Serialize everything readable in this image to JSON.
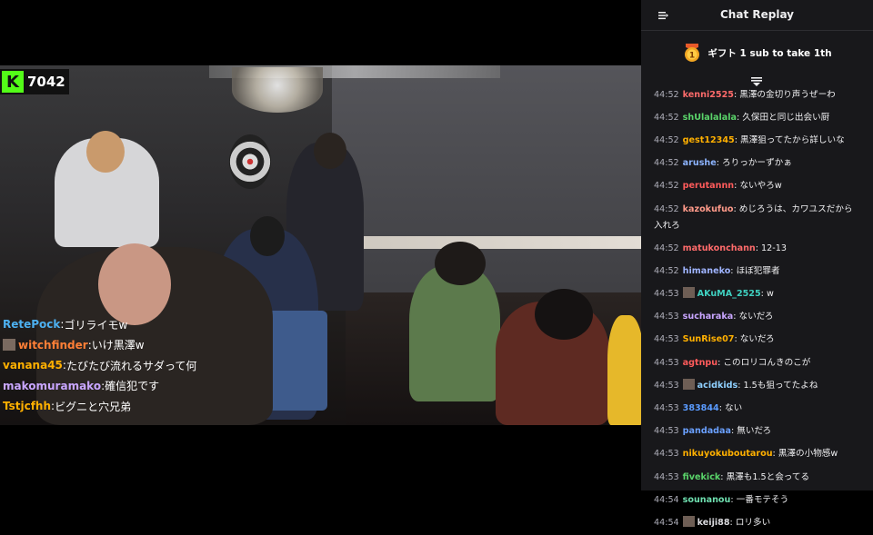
{
  "player": {
    "viewer_count": "7042",
    "overlay_chat": [
      {
        "user": "RetePock",
        "color": "#4db0f0",
        "message": "ゴリライモw",
        "badge": false
      },
      {
        "user": "witchfinder",
        "color": "#ff7f36",
        "message": "いけ黒澤w",
        "badge": true
      },
      {
        "user": "vanana45",
        "color": "#ffb000",
        "message": "たびたび流れるサダって何",
        "badge": false
      },
      {
        "user": "makomuramako",
        "color": "#c9a6ff",
        "message": "確信犯です",
        "badge": false
      },
      {
        "user": "Tstjcfhh",
        "color": "#ffb000",
        "message": "ビグニと穴兄弟",
        "badge": false
      }
    ]
  },
  "panel": {
    "title": "Chat Replay",
    "gift_text": "ギフト 1 sub to take 1th",
    "gift_rank": "1",
    "messages": [
      {
        "time": "44:52",
        "user": "kenni2525",
        "color": "#ff6b6b",
        "message": "黒澤の金切り声うぜーわ",
        "badge": false
      },
      {
        "time": "44:52",
        "user": "shUlalalala",
        "color": "#5ad46a",
        "message": "久保田と同じ出会い厨",
        "badge": false
      },
      {
        "time": "44:52",
        "user": "gest12345",
        "color": "#ffb000",
        "message": "黒澤狙ってたから詳しいな",
        "badge": false
      },
      {
        "time": "44:52",
        "user": "arushe",
        "color": "#8db4ff",
        "message": "ろりっかーずかぁ",
        "badge": false
      },
      {
        "time": "44:52",
        "user": "perutannn",
        "color": "#ff5b5b",
        "message": "ないやろw",
        "badge": false
      },
      {
        "time": "44:52",
        "user": "kazokufuo",
        "color": "#ff9a8a",
        "message": "めじろうは、カワユスだから入れろ",
        "badge": false
      },
      {
        "time": "44:52",
        "user": "matukonchann",
        "color": "#ff6b6b",
        "message": "12-13",
        "badge": false
      },
      {
        "time": "44:52",
        "user": "himaneko",
        "color": "#9fb4ff",
        "message": "ほぼ犯罪者",
        "badge": false
      },
      {
        "time": "44:53",
        "user": "AKuMA_2525",
        "color": "#3fd0c0",
        "message": "w",
        "badge": true
      },
      {
        "time": "44:53",
        "user": "sucharaka",
        "color": "#c9a6ff",
        "message": "ないだろ",
        "badge": false
      },
      {
        "time": "44:53",
        "user": "SunRise07",
        "color": "#ffb000",
        "message": "ないだろ",
        "badge": false
      },
      {
        "time": "44:53",
        "user": "agtnpu",
        "color": "#ff5b5b",
        "message": "このロリコんきのこが",
        "badge": false
      },
      {
        "time": "44:53",
        "user": "acidkids",
        "color": "#8fd0ff",
        "message": "1.5も狙ってたよね",
        "badge": true
      },
      {
        "time": "44:53",
        "user": "383844",
        "color": "#5a9bff",
        "message": "ない",
        "badge": false
      },
      {
        "time": "44:53",
        "user": "pandadaa",
        "color": "#6aa0ff",
        "message": "無いだろ",
        "badge": false
      },
      {
        "time": "44:53",
        "user": "nikuyokuboutarou",
        "color": "#ffb000",
        "message": "黒澤の小物感w",
        "badge": false
      },
      {
        "time": "44:53",
        "user": "fivekick",
        "color": "#5ad46a",
        "message": "黒澤も1.5と会ってる",
        "badge": false
      },
      {
        "time": "44:54",
        "user": "sounanou",
        "color": "#6fe0b0",
        "message": "一番モテそう",
        "badge": false
      },
      {
        "time": "44:54",
        "user": "keiji88",
        "color": "#dcdce0",
        "message": "ロリ多い",
        "badge": true
      }
    ]
  }
}
